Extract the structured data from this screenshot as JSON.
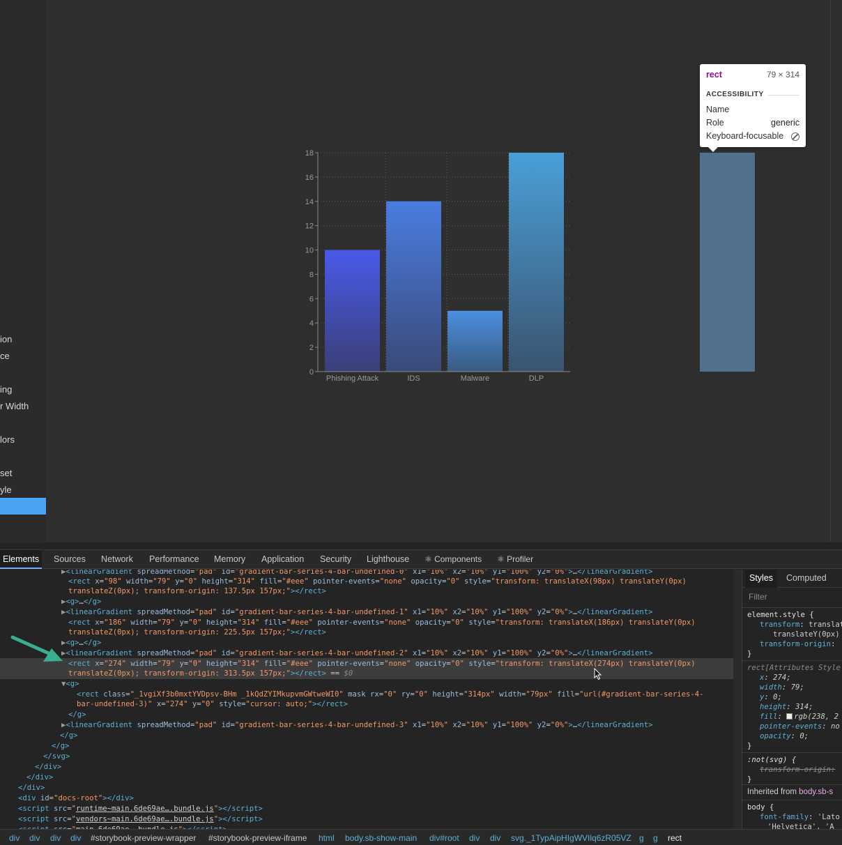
{
  "sidebar": {
    "items": [
      "ion",
      "ce",
      "ing",
      "r Width",
      "lors",
      "set",
      "yle"
    ]
  },
  "chart_data": {
    "type": "bar",
    "categories": [
      "Phishing Attack",
      "IDS",
      "Malware",
      "DLP"
    ],
    "values": [
      10,
      14,
      5,
      18
    ],
    "ylim": [
      0,
      18
    ],
    "yticks": [
      0,
      2,
      4,
      6,
      8,
      10,
      12,
      14,
      16,
      18
    ],
    "grid": true,
    "title": "",
    "xlabel": "",
    "ylabel": "",
    "colors_top": [
      "#4a5ae8",
      "#4a7de0",
      "#4a90e2",
      "#4a9fd8"
    ],
    "colors_bottom": [
      "#3a3f78",
      "#3a4a78",
      "#3a5a80",
      "#3a5470"
    ]
  },
  "tooltip": {
    "tag": "rect",
    "size": "79 × 314",
    "section": "ACCESSIBILITY",
    "name_label": "Name",
    "role_label": "Role",
    "role_value": "generic",
    "keyboard_label": "Keyboard-focusable"
  },
  "devtools": {
    "tabs": [
      "Elements",
      "Sources",
      "Network",
      "Performance",
      "Memory",
      "Application",
      "Security",
      "Lighthouse",
      "⚛ Components",
      "⚛ Profiler"
    ],
    "styles_tabs": [
      "Styles",
      "Computed"
    ],
    "filter_placeholder": "Filter",
    "breadcrumb": [
      "div",
      "div",
      "div",
      "div",
      "#storybook-preview-wrapper",
      "#storybook-preview-iframe",
      "html",
      "body.sb-show-main",
      "div#root",
      "div",
      "div",
      "svg._1TypAipHIgWVIlq6zR05VZ",
      "g",
      "g",
      "rect"
    ]
  }
}
